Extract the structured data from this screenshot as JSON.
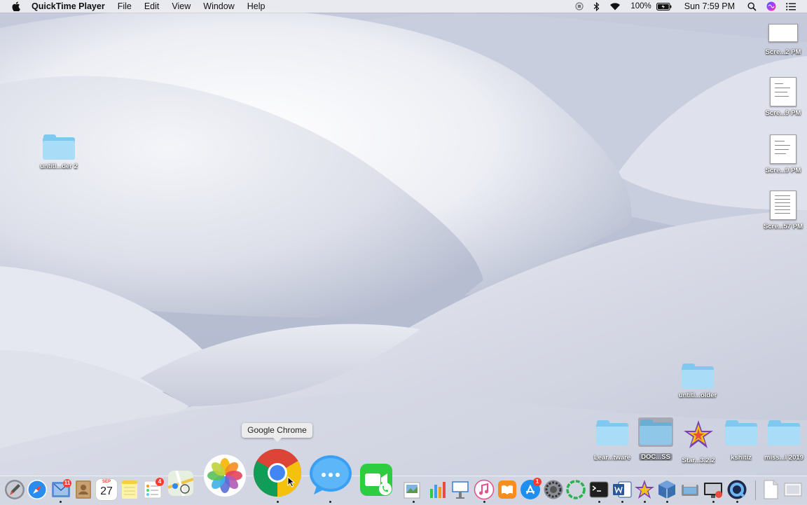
{
  "menubar": {
    "app_name": "QuickTime Player",
    "menus": [
      "File",
      "Edit",
      "View",
      "Window",
      "Help"
    ],
    "battery": "100%",
    "clock": "Sun 7:59 PM"
  },
  "desktop": {
    "left_folder": "untitl...der 2",
    "screenshots": [
      "Scre...2 PM",
      "Scre...9 PM",
      "Scre...9 PM",
      "Scre...57 PM"
    ],
    "folder_untitled_older": "untitl...older",
    "bottom_row": [
      "Lear...tware",
      "DOC...SS",
      "Star...3.2.2",
      "kshitiz",
      "miss...l 2019"
    ]
  },
  "dock": {
    "tooltip": "Google Chrome",
    "badges": {
      "mail": "11",
      "reminders": "4",
      "appstore": "1"
    },
    "calendar": {
      "month": "SEP",
      "day": "27"
    }
  },
  "colors": {
    "folder": "#7fc8ef",
    "badge": "#ff3b30",
    "menubar": "#ececf0"
  }
}
